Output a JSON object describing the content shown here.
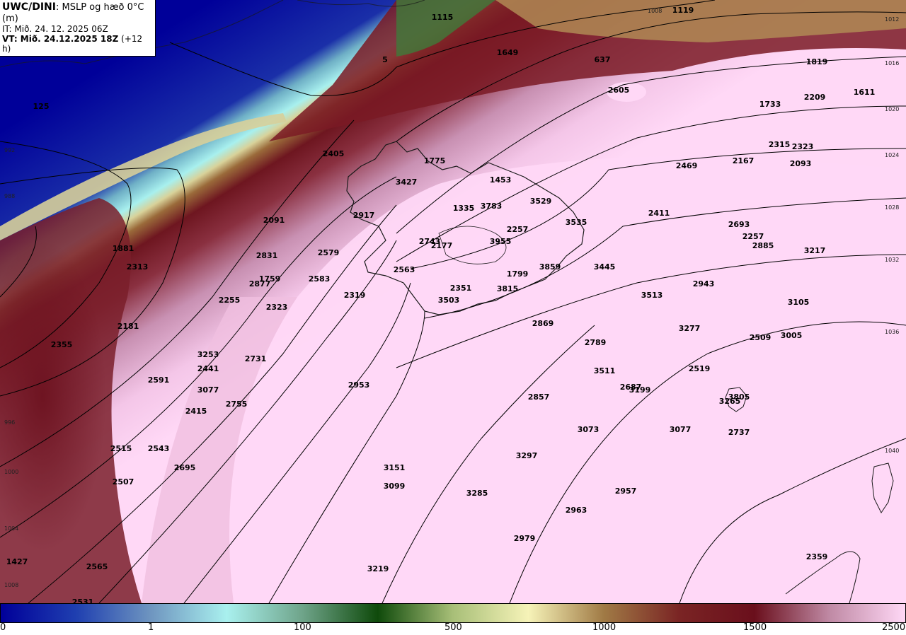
{
  "header": {
    "title_bold": "UWC/DINI",
    "title_rest": ": MSLP og hæð 0°C (m)",
    "init_time": "IT: Mið. 24. 12. 2025 06Z",
    "valid_prefix": "VT: Mið. 24.12.2025 18Z",
    "valid_suffix": " (+12 h)"
  },
  "colorbar": {
    "tick_labels": [
      "0",
      "1",
      "100",
      "500",
      "1000",
      "1500",
      "2500"
    ],
    "colors": [
      "#000099",
      "#1f3fb0",
      "#6f96c0",
      "#a9f0ee",
      "#6fa48a",
      "#0f4a0b",
      "#a8bf78",
      "#f6f3b8",
      "#a07a45",
      "#7a2424",
      "#6a0f1c",
      "#c08aa5",
      "#ffd8f6"
    ]
  },
  "isobar_labels": [
    "1008",
    "1012",
    "1016",
    "1020",
    "1024",
    "1028",
    "1032",
    "1036",
    "1040",
    "988",
    "992",
    "996",
    "1000",
    "1004",
    "1008"
  ],
  "height_labels": [
    "1115",
    "1119",
    "1649",
    "637",
    "1819",
    "5",
    "125",
    "2605",
    "1611",
    "2209",
    "1733",
    "2405",
    "1775",
    "2315",
    "2323",
    "2469",
    "2167",
    "2093",
    "3427",
    "1453",
    "3529",
    "2917",
    "1335",
    "3783",
    "2091",
    "2411",
    "3535",
    "2693",
    "2257",
    "2257",
    "2885",
    "1881",
    "3217",
    "2831",
    "2579",
    "2743",
    "2177",
    "3955",
    "2313",
    "3445",
    "2563",
    "1799",
    "3859",
    "2877",
    "1759",
    "2583",
    "2351",
    "3815",
    "2319",
    "3513",
    "2943",
    "3105",
    "2255",
    "3503",
    "2323",
    "2181",
    "2869",
    "3277",
    "2355",
    "2509",
    "3005",
    "2789",
    "3253",
    "2731",
    "3511",
    "2519",
    "2441",
    "2591",
    "2687",
    "3199",
    "3077",
    "2953",
    "2857",
    "3265",
    "3805",
    "2415",
    "2755",
    "3073",
    "3077",
    "2737",
    "2515",
    "2543",
    "3297",
    "2695",
    "3151",
    "2507",
    "3099",
    "3285",
    "2957",
    "2963",
    "2979",
    "2359",
    "1427",
    "2565",
    "3219",
    "2531"
  ]
}
